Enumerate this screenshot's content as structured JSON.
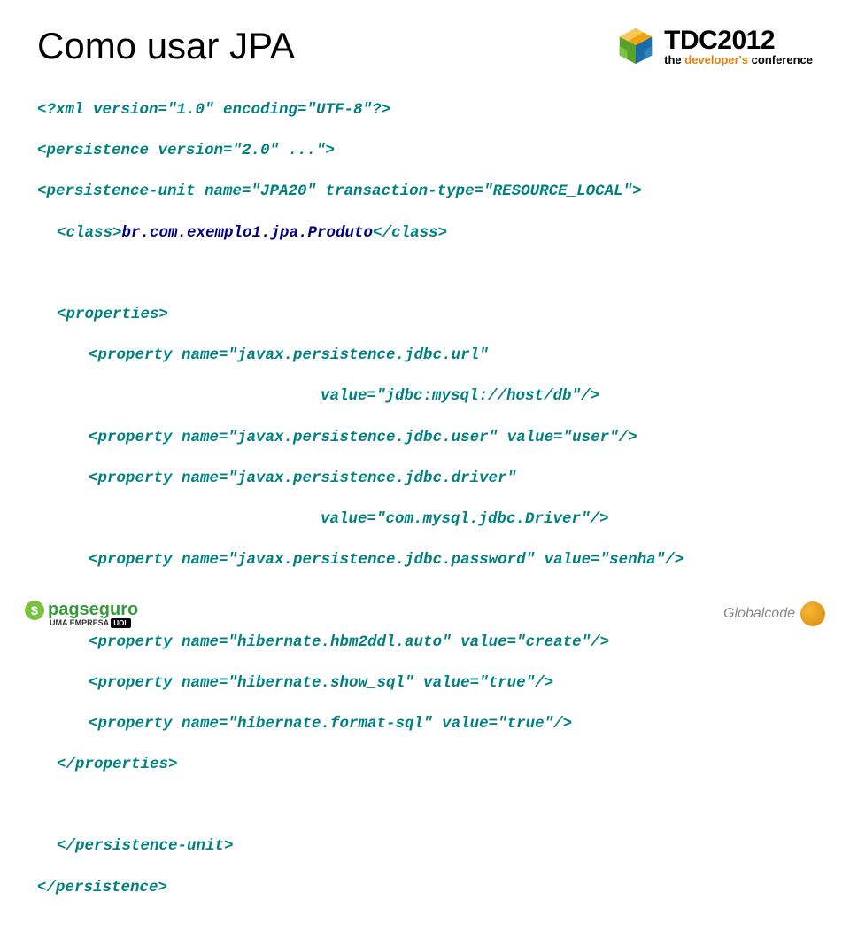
{
  "title": "Como usar JPA",
  "logo": {
    "main": "TDC2012",
    "sub_the": "the ",
    "sub_dev": "developer's",
    "sub_conf": " conference"
  },
  "code": {
    "l1a": "<?xml version=\"1.0\" encoding=\"UTF-8\"?>",
    "l2a": "<persistence version=\"2.0\" ...\">",
    "l3a": "<persistence-unit name=\"JPA20\" transaction-type=\"RESOURCE_LOCAL\">",
    "l4a": "<class>",
    "l4b": "br.com.exemplo1.jpa.Produto",
    "l4c": "</class>",
    "l5a": "<properties>",
    "l6a": "<property name=\"javax.persistence.jdbc.url\"",
    "l7a": "value=\"jdbc:mysql://host/db\"/>",
    "l8a": "<property name=\"javax.persistence.jdbc.user\" value=\"user\"/>",
    "l9a": "<property name=\"javax.persistence.jdbc.driver\"",
    "l10a": "value=\"com.mysql.jdbc.Driver\"/>",
    "l11a": "<property name=\"javax.persistence.jdbc.password\" value=\"senha\"/>",
    "l12a": "<property name=\"hibernate.hbm2ddl.auto\" value=\"create\"/>",
    "l13a": "<property name=\"hibernate.show_sql\" value=\"true\"/>",
    "l14a": "<property name=\"hibernate.format-sql\" value=\"true\"/>",
    "l15a": "</properties>",
    "l16a": "</persistence-unit>",
    "l17a": "</persistence>"
  },
  "footer": {
    "pagseguro": "pagseguro",
    "pagseguro_sub": "UMA EMPRESA ",
    "uol": "UOL",
    "globalcode": "Globalcode"
  }
}
